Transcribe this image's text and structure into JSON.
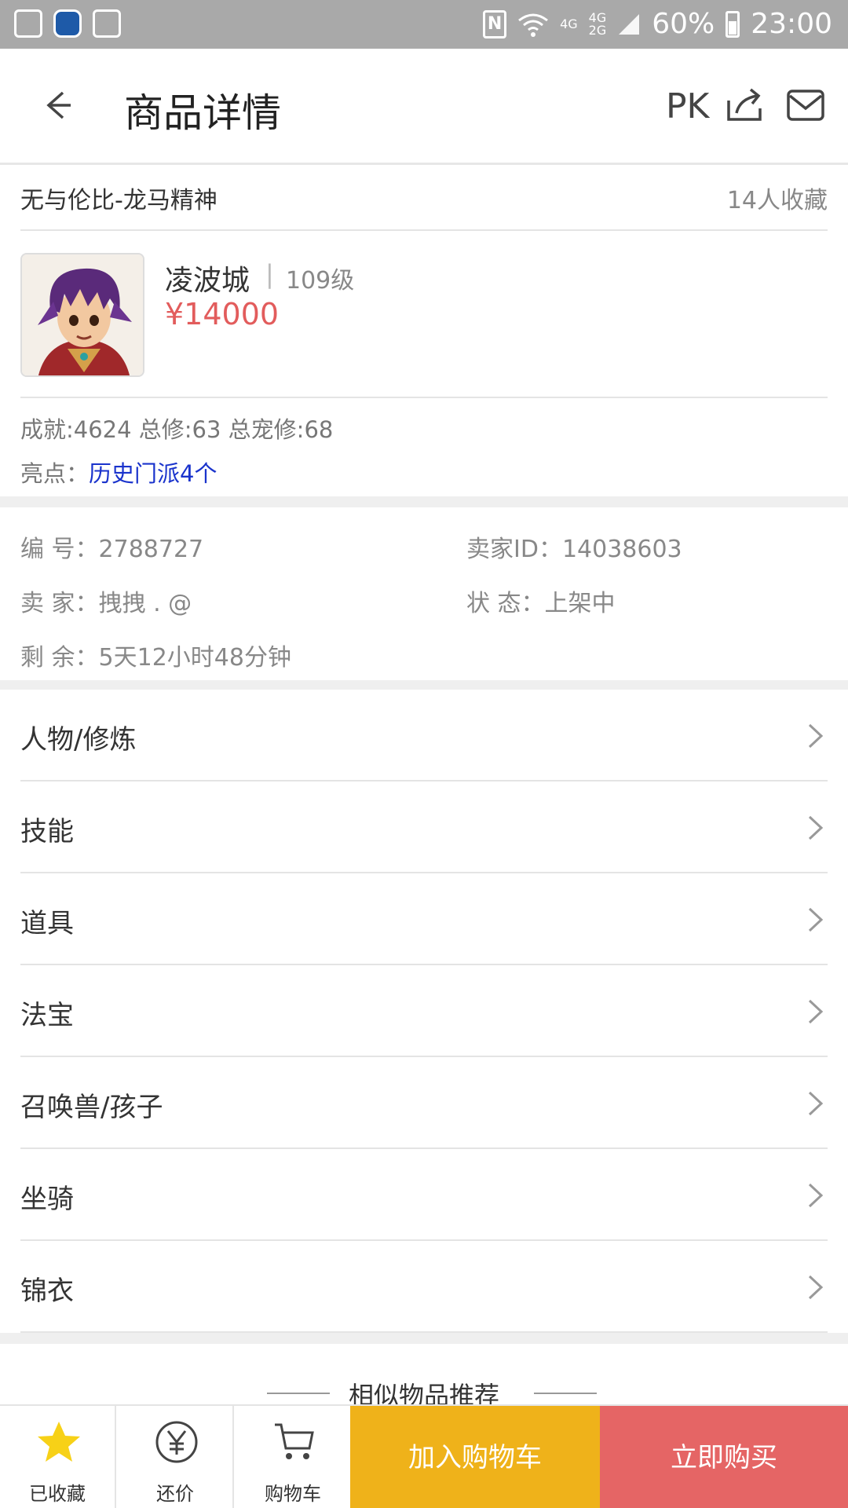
{
  "status_bar": {
    "network_top": "4G",
    "network_bottom": "2G",
    "network_alt": "4G",
    "battery": "60%",
    "time": "23:00"
  },
  "app_bar": {
    "title": "商品详情",
    "pk_label": "PK"
  },
  "product": {
    "name": "无与伦比-龙马精神",
    "favorites": "14人收藏",
    "server": "凌波城",
    "level": "109级",
    "price": "¥14000",
    "stats": "成就:4624 总修:63 总宠修:68",
    "highlight_label": "亮点：",
    "highlight_value": "历史门派4个"
  },
  "details": {
    "number": "编  号：2788727",
    "seller_id": "卖家ID：14038603",
    "seller": "卖  家：拽拽 . @",
    "status": "状  态：上架中",
    "remaining": "剩  余：5天12小时48分钟"
  },
  "sections": [
    {
      "label": "人物/修炼"
    },
    {
      "label": "技能"
    },
    {
      "label": "道具"
    },
    {
      "label": "法宝"
    },
    {
      "label": "召唤兽/孩子"
    },
    {
      "label": "坐骑"
    },
    {
      "label": "锦衣"
    }
  ],
  "recommend_title": "相似物品推荐",
  "bottom_bar": {
    "favorite": "已收藏",
    "bargain": "还价",
    "cart": "购物车",
    "add_cart": "加入购物车",
    "buy_now": "立即购买"
  },
  "colors": {
    "price": "#e25c5c",
    "add_cart_bg": "#efb21a",
    "buy_bg": "#e56565",
    "link": "#1a33cc"
  }
}
